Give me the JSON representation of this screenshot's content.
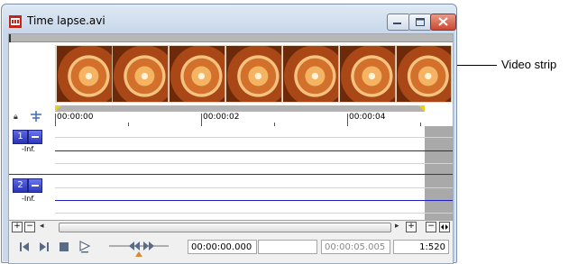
{
  "window": {
    "title": "Time lapse.avi"
  },
  "video_strip": {
    "frame_count": 7
  },
  "ruler": {
    "labels": [
      "00:00:00",
      "00:00:02",
      "00:00:04"
    ]
  },
  "tracks": [
    {
      "number": "1",
      "level_label": "-Inf."
    },
    {
      "number": "2",
      "level_label": "-Inf."
    }
  ],
  "scroll": {
    "add_label": "+",
    "remove_label": "−",
    "zoom_in_label": "+",
    "zoom_out_label": "−"
  },
  "transport": {
    "current_time": "00:00:00.000",
    "duration": "00:00:05.005",
    "zoom_ratio": "1:520"
  },
  "callout": {
    "label": "Video strip"
  },
  "icons": [
    "app-icon",
    "minimize-icon",
    "maximize-icon",
    "close-icon",
    "lock-icon",
    "snap-icon",
    "go-to-start-icon",
    "go-to-end-icon",
    "stop-icon",
    "play-icon",
    "shuttle-icon"
  ]
}
